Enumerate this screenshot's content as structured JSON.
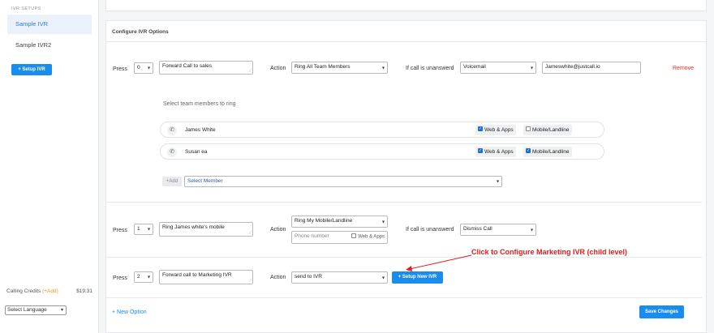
{
  "sidebar": {
    "heading": "IVR SETUPS",
    "items": [
      {
        "label": "Sample IVR",
        "active": true
      },
      {
        "label": "Sample IVR2",
        "active": false
      }
    ],
    "setup_button": "+ Setup IVR",
    "credits_label": "Calling Credits",
    "credits_add": "(+Add)",
    "credits_amount": "$19.31",
    "language": "Select Language"
  },
  "panel": {
    "title": "Configure IVR Options",
    "press_label": "Press",
    "action_label": "Action",
    "unanswered_label": "If call is unanswerd",
    "options": [
      {
        "key": "0",
        "description": "Forward Call to sales",
        "action": "Ring All Team Members",
        "unanswered": "Voicemail",
        "email": "Jameswhite@justcall.io",
        "remove": "Remove"
      },
      {
        "key": "1",
        "description": "Ring James white's mobile",
        "action": "Ring My Mobile/Landline",
        "unanswered": "Dismiss Call",
        "phone_placeholder": "Phone number",
        "web_apps": "Web & Apps"
      },
      {
        "key": "2",
        "description": "Forward call to Marketing IVR",
        "action": "send to IVR",
        "setup_new": "+ Setup New IVR"
      }
    ],
    "team_heading": "Select team members to ring",
    "members": [
      {
        "name": "James White",
        "web": "Web & Apps",
        "web_on": true,
        "mobile": "Mobile/Landline",
        "mobile_on": false
      },
      {
        "name": "Susan ea",
        "web": "Web & Apps",
        "web_on": true,
        "mobile": "Mobile/Landline",
        "mobile_on": true
      }
    ],
    "add_tag": "+Add",
    "member_select": "Select Member",
    "annotation": "Click to Configure Marketing IVR (child level)",
    "new_option": "+ New Option",
    "save": "Save Changes"
  },
  "colors": {
    "accent": "#1a8cf0",
    "remove": "#e0302a",
    "annotation": "#e21c1c"
  },
  "icons": [
    "phone-icon",
    "caret-down-icon",
    "check-icon",
    "arrow-icon"
  ]
}
